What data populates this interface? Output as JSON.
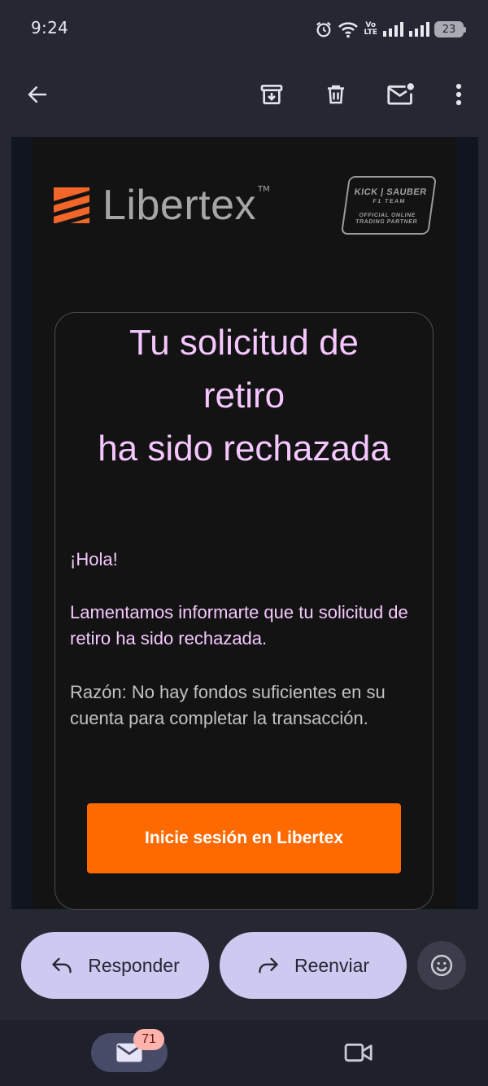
{
  "status_bar": {
    "time": "9:24",
    "network_label_top": "Vo",
    "network_label_bottom": "LTE",
    "battery": "23"
  },
  "toolbar": {
    "icons": [
      "back-arrow-icon",
      "archive-icon",
      "delete-icon",
      "mark-unread-icon",
      "more-vert-icon"
    ]
  },
  "email": {
    "brand_name": "Libertex",
    "trademark": "TM",
    "partner_badge": {
      "line1": "KICK | SAUBER",
      "line2": "F1 TEAM",
      "line3": "OFFICIAL ONLINE",
      "line4": "TRADING PARTNER"
    },
    "title_lines": [
      "Tu solicitud de",
      "retiro",
      "ha sido rechazada"
    ],
    "greeting": "¡Hola!",
    "body": "Lamentamos informarte que tu solicitud de retiro ha sido rechazada.",
    "reason": "Razón: No hay fondos suficientes en su cuenta para completar la transacción.",
    "cta_label": "Inicie sesión en Libertex",
    "colors": {
      "title": "#f6c7ff",
      "cta": "#ff6a00",
      "logo_accent": "#f2662a"
    }
  },
  "actions": {
    "reply_label": "Responder",
    "forward_label": "Reenviar"
  },
  "bottom_nav": {
    "mail_unread_count": "71"
  }
}
